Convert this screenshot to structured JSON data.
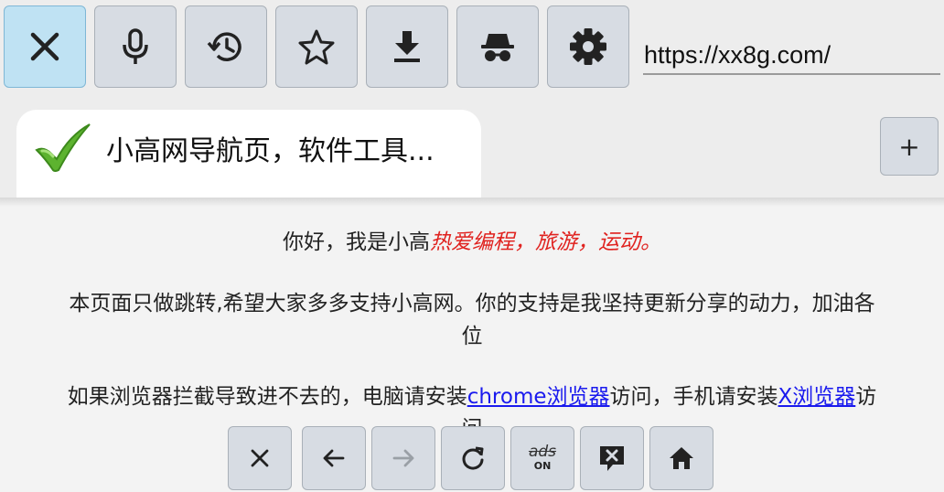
{
  "toolbar": {
    "url": "https://xx8g.com/",
    "buttons": [
      {
        "name": "close-tab-button",
        "icon": "close-icon"
      },
      {
        "name": "voice-search-button",
        "icon": "microphone-icon"
      },
      {
        "name": "history-button",
        "icon": "history-icon"
      },
      {
        "name": "bookmark-button",
        "icon": "star-icon"
      },
      {
        "name": "download-button",
        "icon": "download-icon"
      },
      {
        "name": "incognito-button",
        "icon": "incognito-icon"
      },
      {
        "name": "settings-button",
        "icon": "gear-icon"
      }
    ]
  },
  "tabs": {
    "active_title": "小高网导航页，软件工具...",
    "new_tab_label": "+"
  },
  "content": {
    "greeting_prefix": "你好，我是小高",
    "greeting_highlight": "热爱编程，旅游，运动。",
    "line2_a": "本页面只做跳转,希望大家多多支持小高网。你的支持是我坚持更新分享的动力，加油各",
    "line2_b": "位",
    "line3_a": "如果浏览器拦截导致进不去的，电脑请安装",
    "line3_link1": "chrome浏览器",
    "line3_b": "访问，手机请安装",
    "line3_link2": "X浏览器",
    "line3_c": "访",
    "line3_wrap": "问"
  },
  "bottom_nav": {
    "ads_label_top": "ads",
    "ads_label_bottom": "ON"
  },
  "colors": {
    "button_bg": "#d7dce3",
    "active_button_bg": "#bfe2f3",
    "highlight_red": "#e0221f",
    "link_blue": "#1a1aee"
  }
}
